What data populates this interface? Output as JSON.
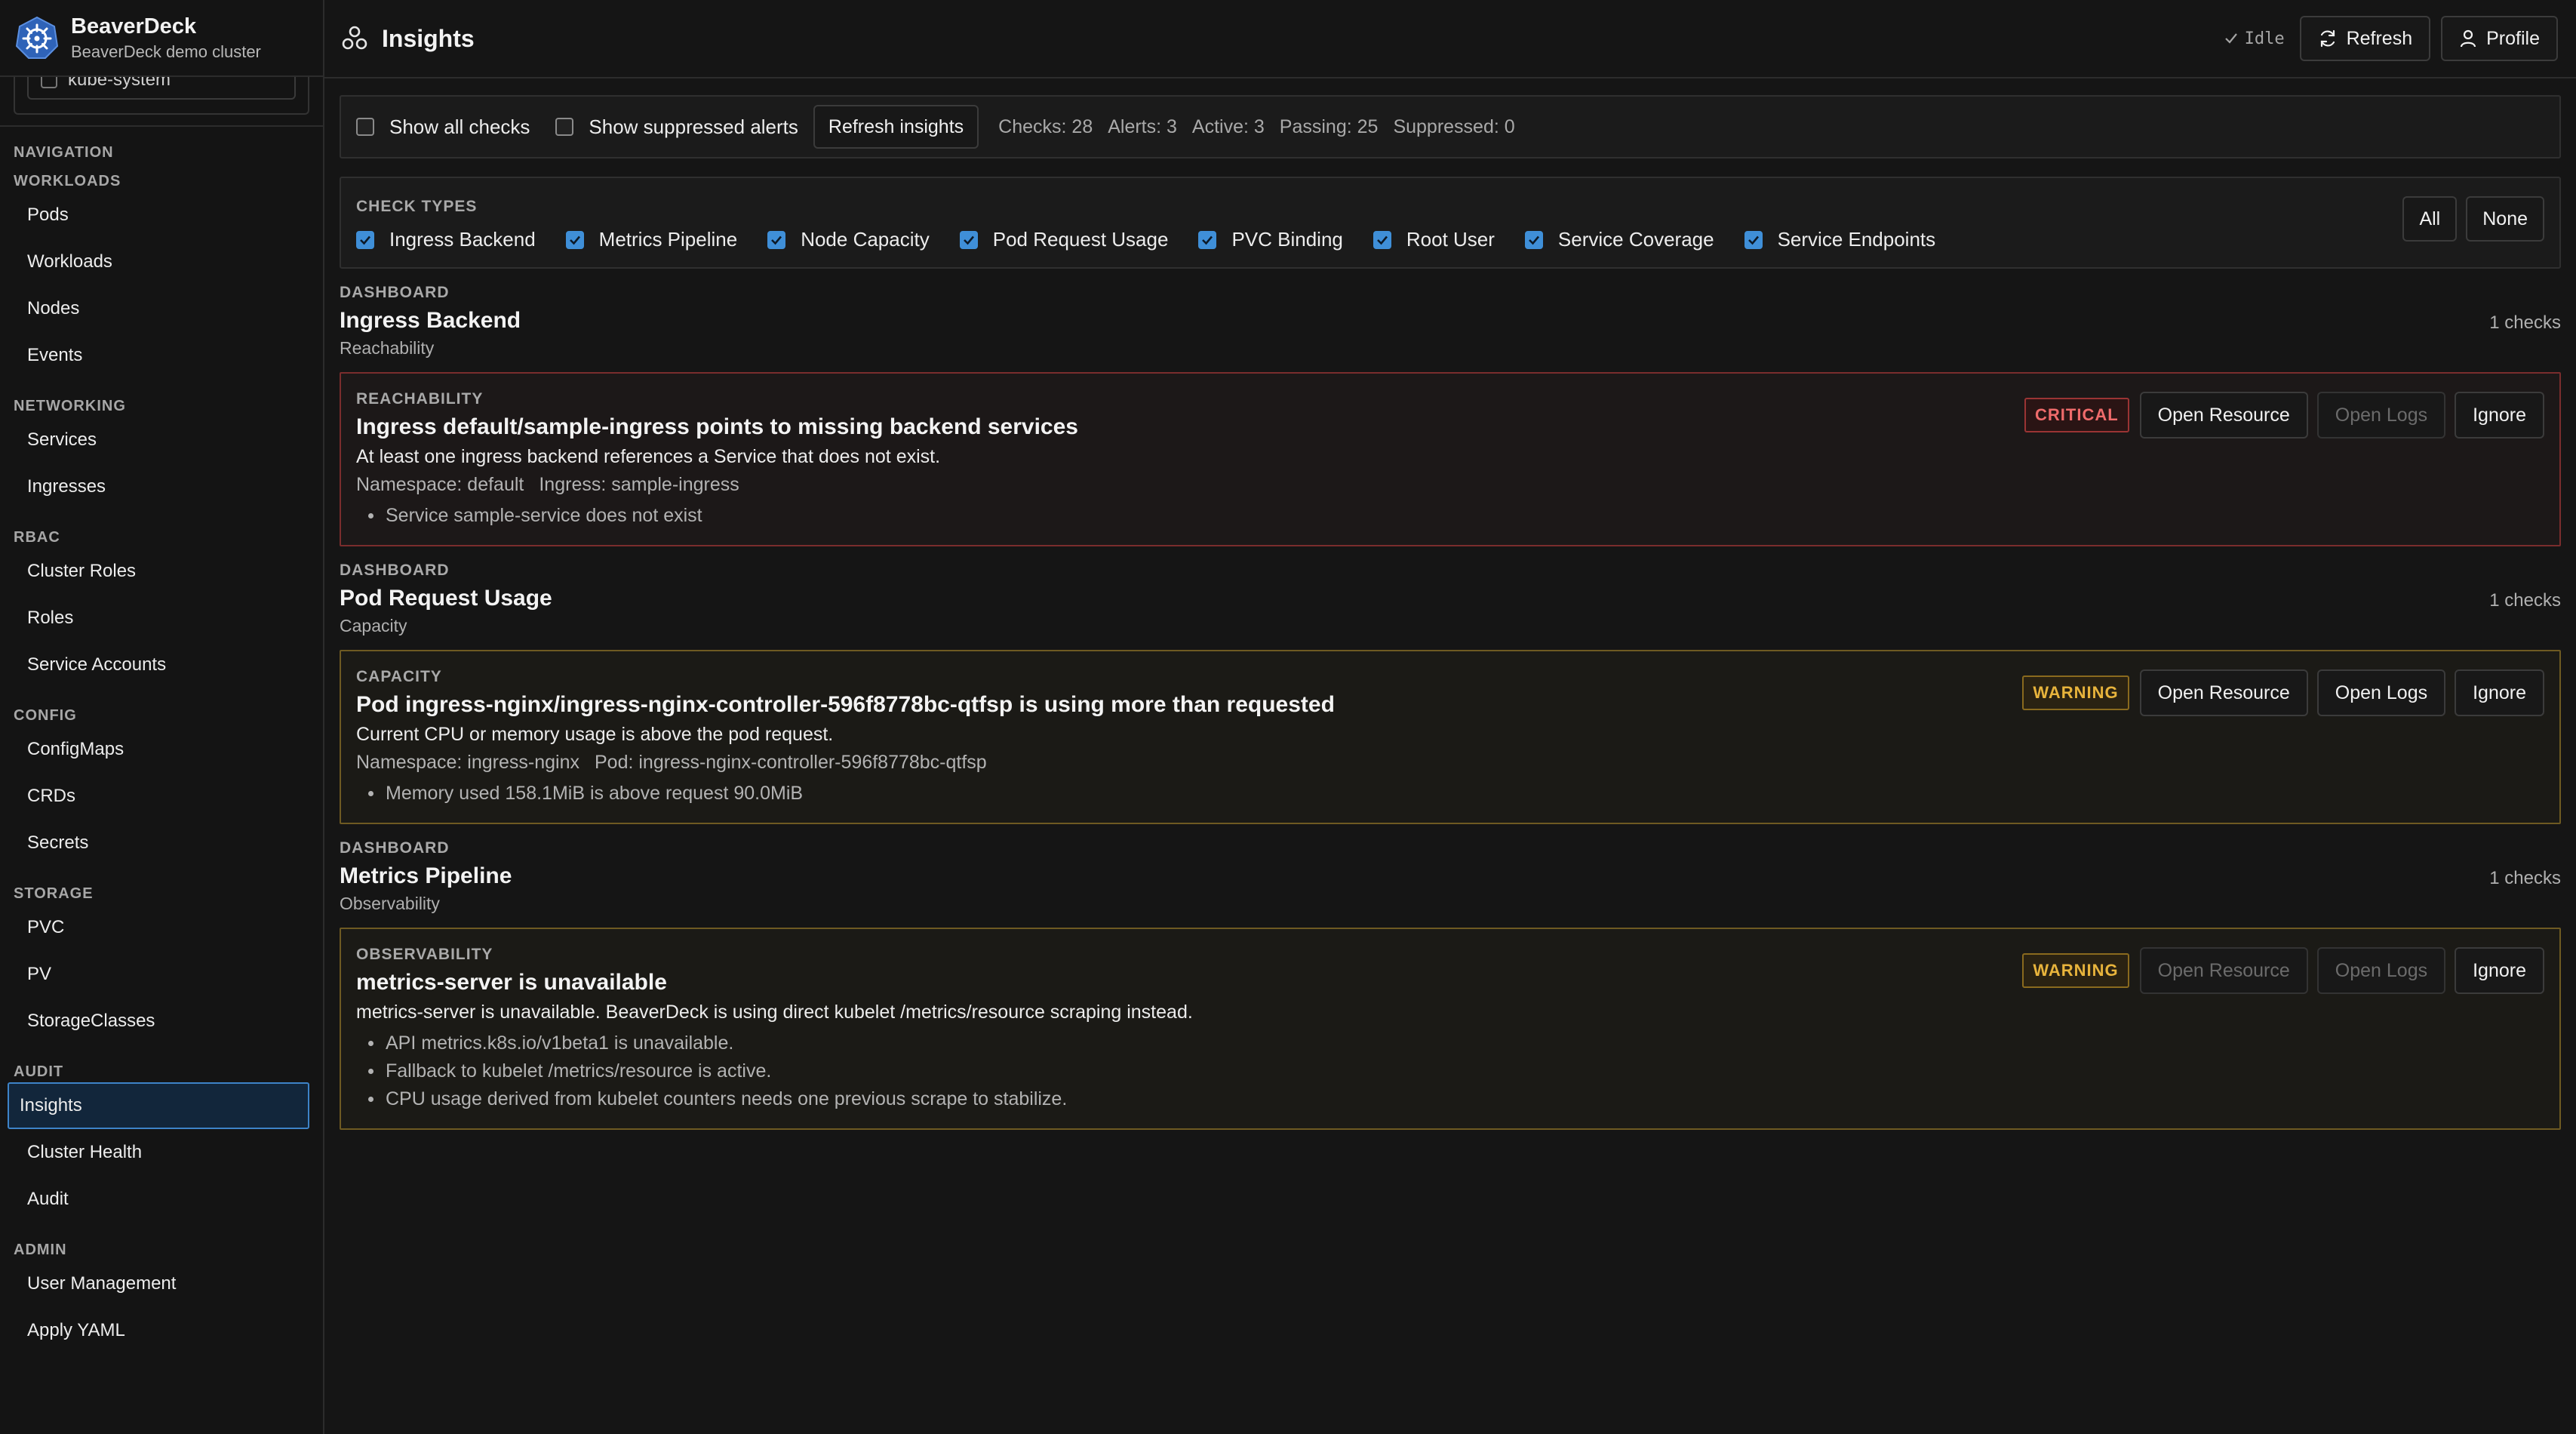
{
  "brand": {
    "name": "BeaverDeck",
    "subtitle": "BeaverDeck demo cluster"
  },
  "namespace_peek": {
    "value": "kube-system"
  },
  "sidebar": {
    "navigation_heading": "NAVIGATION",
    "groups": [
      {
        "heading": "WORKLOADS",
        "items": [
          "Pods",
          "Workloads",
          "Nodes",
          "Events"
        ]
      },
      {
        "heading": "NETWORKING",
        "items": [
          "Services",
          "Ingresses"
        ]
      },
      {
        "heading": "RBAC",
        "items": [
          "Cluster Roles",
          "Roles",
          "Service Accounts"
        ]
      },
      {
        "heading": "CONFIG",
        "items": [
          "ConfigMaps",
          "CRDs",
          "Secrets"
        ]
      },
      {
        "heading": "STORAGE",
        "items": [
          "PVC",
          "PV",
          "StorageClasses"
        ]
      },
      {
        "heading": "AUDIT",
        "items": [
          "Insights",
          "Cluster Health",
          "Audit"
        ]
      },
      {
        "heading": "ADMIN",
        "items": [
          "User Management",
          "Apply YAML"
        ]
      }
    ],
    "active_item": "Insights"
  },
  "header": {
    "title": "Insights",
    "status": "Idle",
    "refresh_label": "Refresh",
    "profile_label": "Profile"
  },
  "filters": {
    "show_all_checks": {
      "label": "Show all checks",
      "checked": false
    },
    "show_suppressed": {
      "label": "Show suppressed alerts",
      "checked": false
    },
    "refresh_insights_label": "Refresh insights",
    "stats": {
      "checks": "Checks: 28",
      "alerts": "Alerts: 3",
      "active": "Active: 3",
      "passing": "Passing: 25",
      "suppressed": "Suppressed: 0"
    }
  },
  "check_types": {
    "heading": "CHECK TYPES",
    "all_label": "All",
    "none_label": "None",
    "items": [
      {
        "label": "Ingress Backend",
        "checked": true
      },
      {
        "label": "Metrics Pipeline",
        "checked": true
      },
      {
        "label": "Node Capacity",
        "checked": true
      },
      {
        "label": "Pod Request Usage",
        "checked": true
      },
      {
        "label": "PVC Binding",
        "checked": true
      },
      {
        "label": "Root User",
        "checked": true
      },
      {
        "label": "Service Coverage",
        "checked": true
      },
      {
        "label": "Service Endpoints",
        "checked": true
      }
    ]
  },
  "groups": [
    {
      "kicker": "DASHBOARD",
      "title": "Ingress Backend",
      "subtitle": "Reachability",
      "count": "1 checks",
      "card": {
        "severity": "CRITICAL",
        "kicker": "REACHABILITY",
        "title": "Ingress default/sample-ingress points to missing backend services",
        "description": "At least one ingress backend references a Service that does not exist.",
        "meta": [
          "Namespace: default",
          "Ingress: sample-ingress"
        ],
        "bullets": [
          "Service sample-service does not exist"
        ],
        "open_resource_label": "Open Resource",
        "open_resource_enabled": true,
        "open_logs_label": "Open Logs",
        "open_logs_enabled": false,
        "ignore_label": "Ignore"
      }
    },
    {
      "kicker": "DASHBOARD",
      "title": "Pod Request Usage",
      "subtitle": "Capacity",
      "count": "1 checks",
      "card": {
        "severity": "WARNING",
        "kicker": "CAPACITY",
        "title": "Pod ingress-nginx/ingress-nginx-controller-596f8778bc-qtfsp is using more than requested",
        "description": "Current CPU or memory usage is above the pod request.",
        "meta": [
          "Namespace: ingress-nginx",
          "Pod: ingress-nginx-controller-596f8778bc-qtfsp"
        ],
        "bullets": [
          "Memory used 158.1MiB is above request 90.0MiB"
        ],
        "open_resource_label": "Open Resource",
        "open_resource_enabled": true,
        "open_logs_label": "Open Logs",
        "open_logs_enabled": true,
        "ignore_label": "Ignore"
      }
    },
    {
      "kicker": "DASHBOARD",
      "title": "Metrics Pipeline",
      "subtitle": "Observability",
      "count": "1 checks",
      "card": {
        "severity": "WARNING",
        "kicker": "OBSERVABILITY",
        "title": "metrics-server is unavailable",
        "description": "metrics-server is unavailable. BeaverDeck is using direct kubelet /metrics/resource scraping instead.",
        "meta": [],
        "bullets": [
          "API metrics.k8s.io/v1beta1 is unavailable.",
          "Fallback to kubelet /metrics/resource is active.",
          "CPU usage derived from kubelet counters needs one previous scrape to stabilize."
        ],
        "open_resource_label": "Open Resource",
        "open_resource_enabled": false,
        "open_logs_label": "Open Logs",
        "open_logs_enabled": false,
        "ignore_label": "Ignore"
      }
    }
  ],
  "colors": {
    "accent": "#3f8fd8",
    "critical": "#ef6b6b",
    "warning": "#e8b43c",
    "background": "#151515"
  },
  "icons": {
    "brand": "helm-wheel-icon",
    "insights": "cluster-nodes-icon",
    "status": "check-icon",
    "refresh": "refresh-icon",
    "profile": "user-icon"
  }
}
